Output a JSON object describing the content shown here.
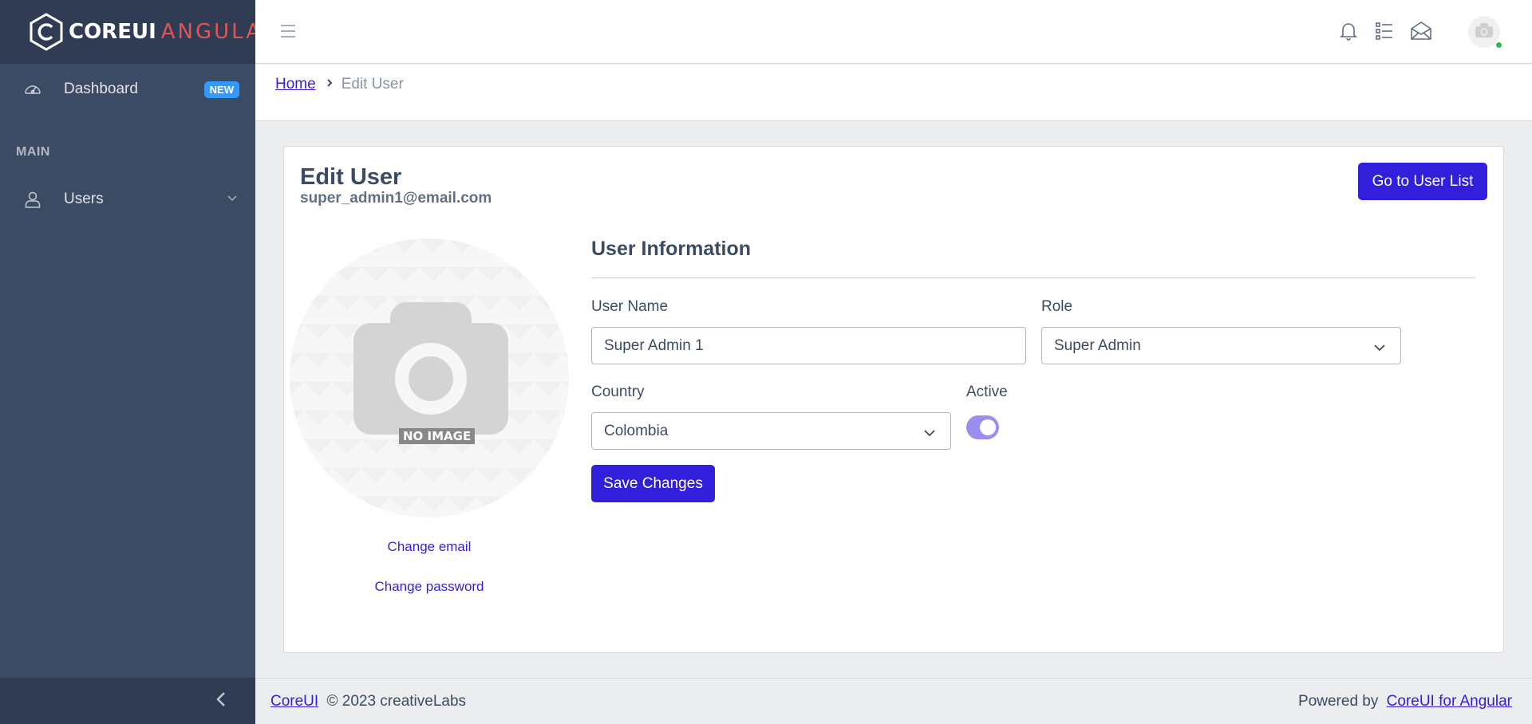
{
  "brand": {
    "core": "COREUI",
    "angular": "ANGULAR"
  },
  "sidebar": {
    "dashboard_label": "Dashboard",
    "dashboard_badge": "NEW",
    "section_title": "MAIN",
    "users_label": "Users"
  },
  "breadcrumb": {
    "home": "Home",
    "current": "Edit User"
  },
  "card": {
    "title": "Edit User",
    "email": "super_admin1@email.com",
    "user_list_button": "Go to User List",
    "no_image_label": "NO IMAGE",
    "change_email": "Change email",
    "change_password": "Change password"
  },
  "form": {
    "section_title": "User Information",
    "username_label": "User Name",
    "username_value": "Super Admin 1",
    "role_label": "Role",
    "role_value": "Super Admin",
    "country_label": "Country",
    "country_value": "Colombia",
    "active_label": "Active",
    "active_value": true,
    "save_button": "Save Changes"
  },
  "footer": {
    "brand_link": "CoreUI",
    "copyright": "© 2023 creativeLabs",
    "powered_by": "Powered by",
    "powered_link": "CoreUI for Angular"
  },
  "colors": {
    "primary": "#321fdb",
    "sidebar": "#3c4b64",
    "badge": "#3399ff",
    "status_online": "#2eb85c"
  }
}
